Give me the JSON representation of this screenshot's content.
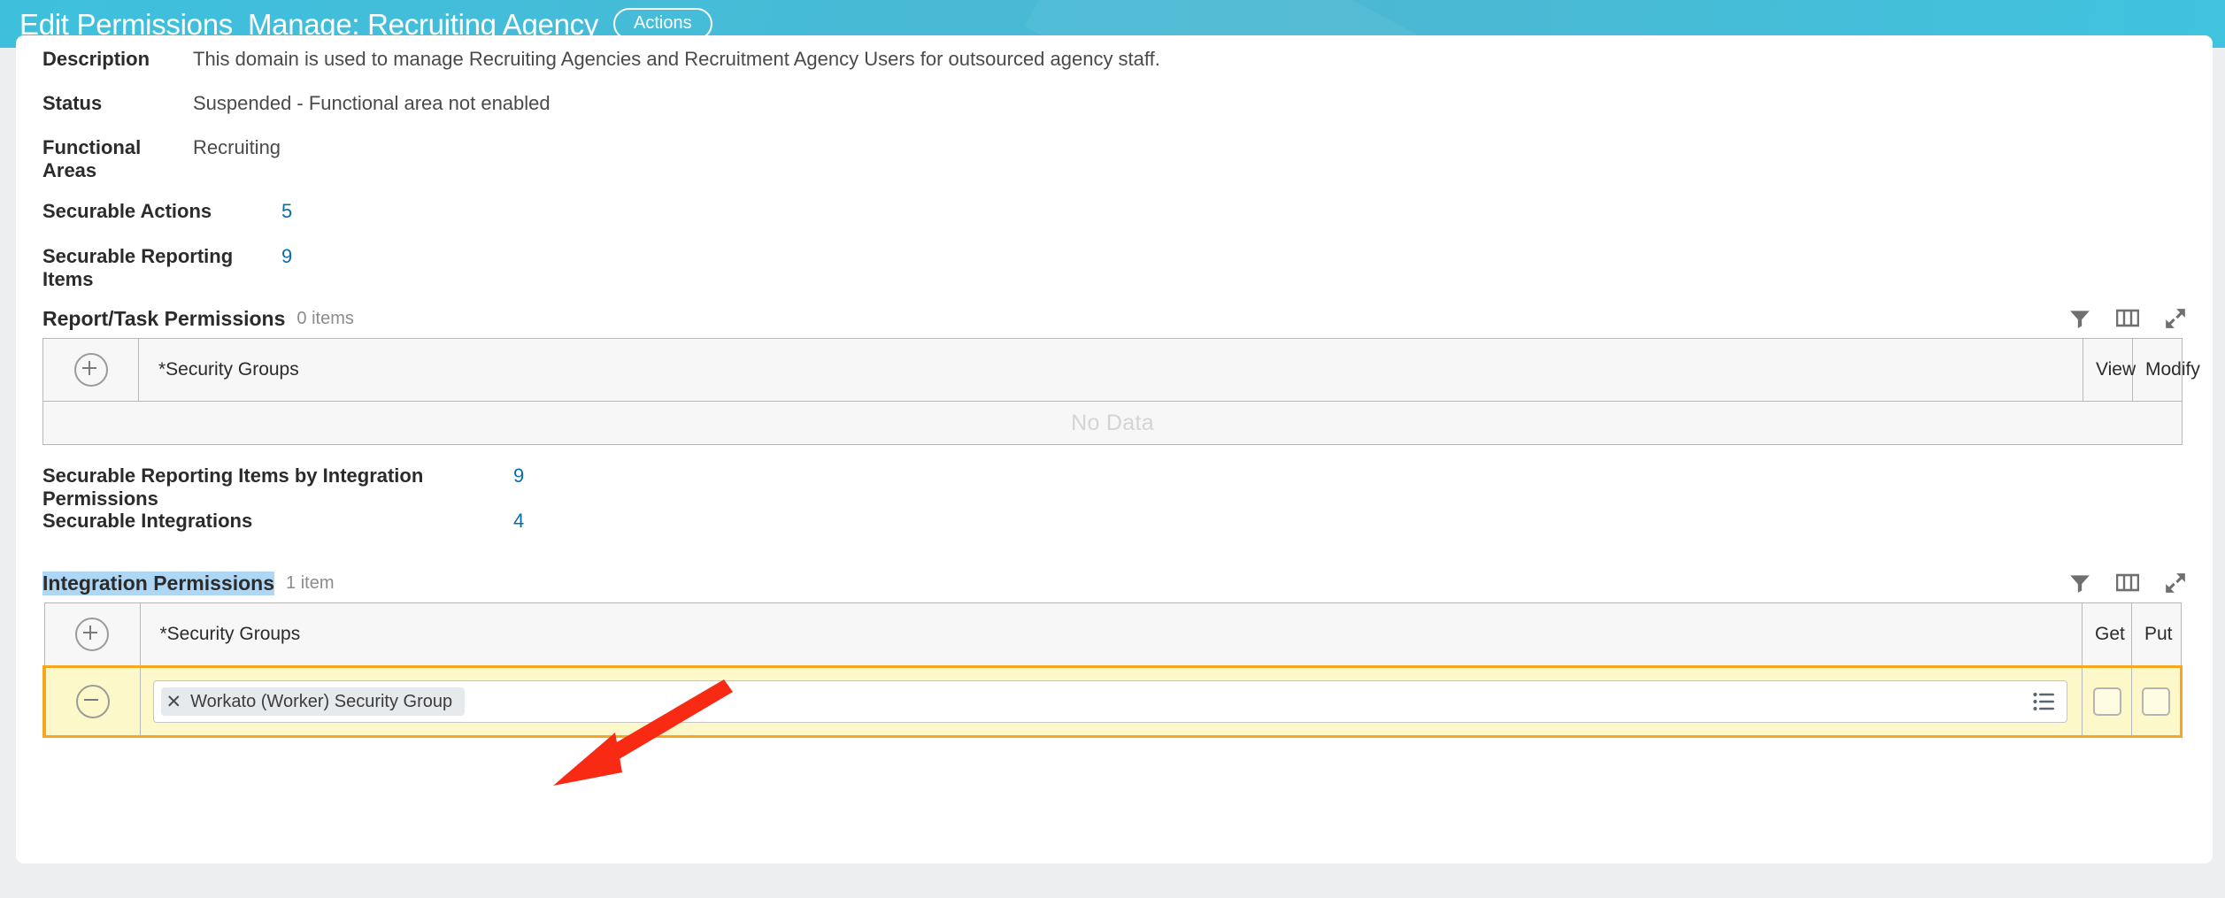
{
  "header": {
    "breadcrumb_title": "Edit Permissions",
    "page_title": "Manage: Recruiting Agency",
    "actions_label": "Actions",
    "accent_color": "#45bcd8"
  },
  "details": {
    "fields": [
      {
        "label": "Description",
        "value": "This domain is used to manage Recruiting Agencies and Recruitment Agency Users for outsourced agency staff."
      },
      {
        "label": "Status",
        "value": "Suspended - Functional area not enabled"
      },
      {
        "label": "Functional Areas",
        "value": "Recruiting"
      }
    ],
    "counts": [
      {
        "label": "Securable Actions",
        "value": "5"
      },
      {
        "label": "Securable Reporting Items",
        "value": "9"
      }
    ],
    "counts2": [
      {
        "label": "Securable Reporting Items by Integration Permissions",
        "value": "9"
      },
      {
        "label": "Securable Integrations",
        "value": "4"
      }
    ],
    "link_color": "#0a6da8"
  },
  "report_task_grid": {
    "title": "Report/Task Permissions",
    "item_count": "0 items",
    "tools": [
      {
        "name": "filter-icon",
        "label": "Filter"
      },
      {
        "name": "columns-icon",
        "label": "Columns"
      },
      {
        "name": "expand-icon",
        "label": "Expand"
      }
    ],
    "columns": [
      "",
      "*Security Groups",
      "View",
      "Modify"
    ],
    "add_row_label": "+",
    "empty_text": "No Data"
  },
  "integration_grid": {
    "title": "Integration Permissions",
    "title_selected": true,
    "item_count": "1 item",
    "tools": [
      {
        "name": "filter-icon",
        "label": "Filter"
      },
      {
        "name": "columns-icon",
        "label": "Columns"
      },
      {
        "name": "expand-icon",
        "label": "Expand"
      }
    ],
    "columns": [
      "",
      "*Security Groups",
      "Get",
      "Put"
    ],
    "add_row_label": "+",
    "rows": [
      {
        "remove_label": "−",
        "security_group": "Workato (Worker) Security Group",
        "pill_remove": "✕",
        "get_checked": false,
        "put_checked": false
      }
    ],
    "selected_row_color": "#fcf8c9",
    "selected_border_color": "#f5a623"
  },
  "annotation": {
    "arrow_color": "#f92a14",
    "arrow_points_to": "security-group-cell"
  }
}
